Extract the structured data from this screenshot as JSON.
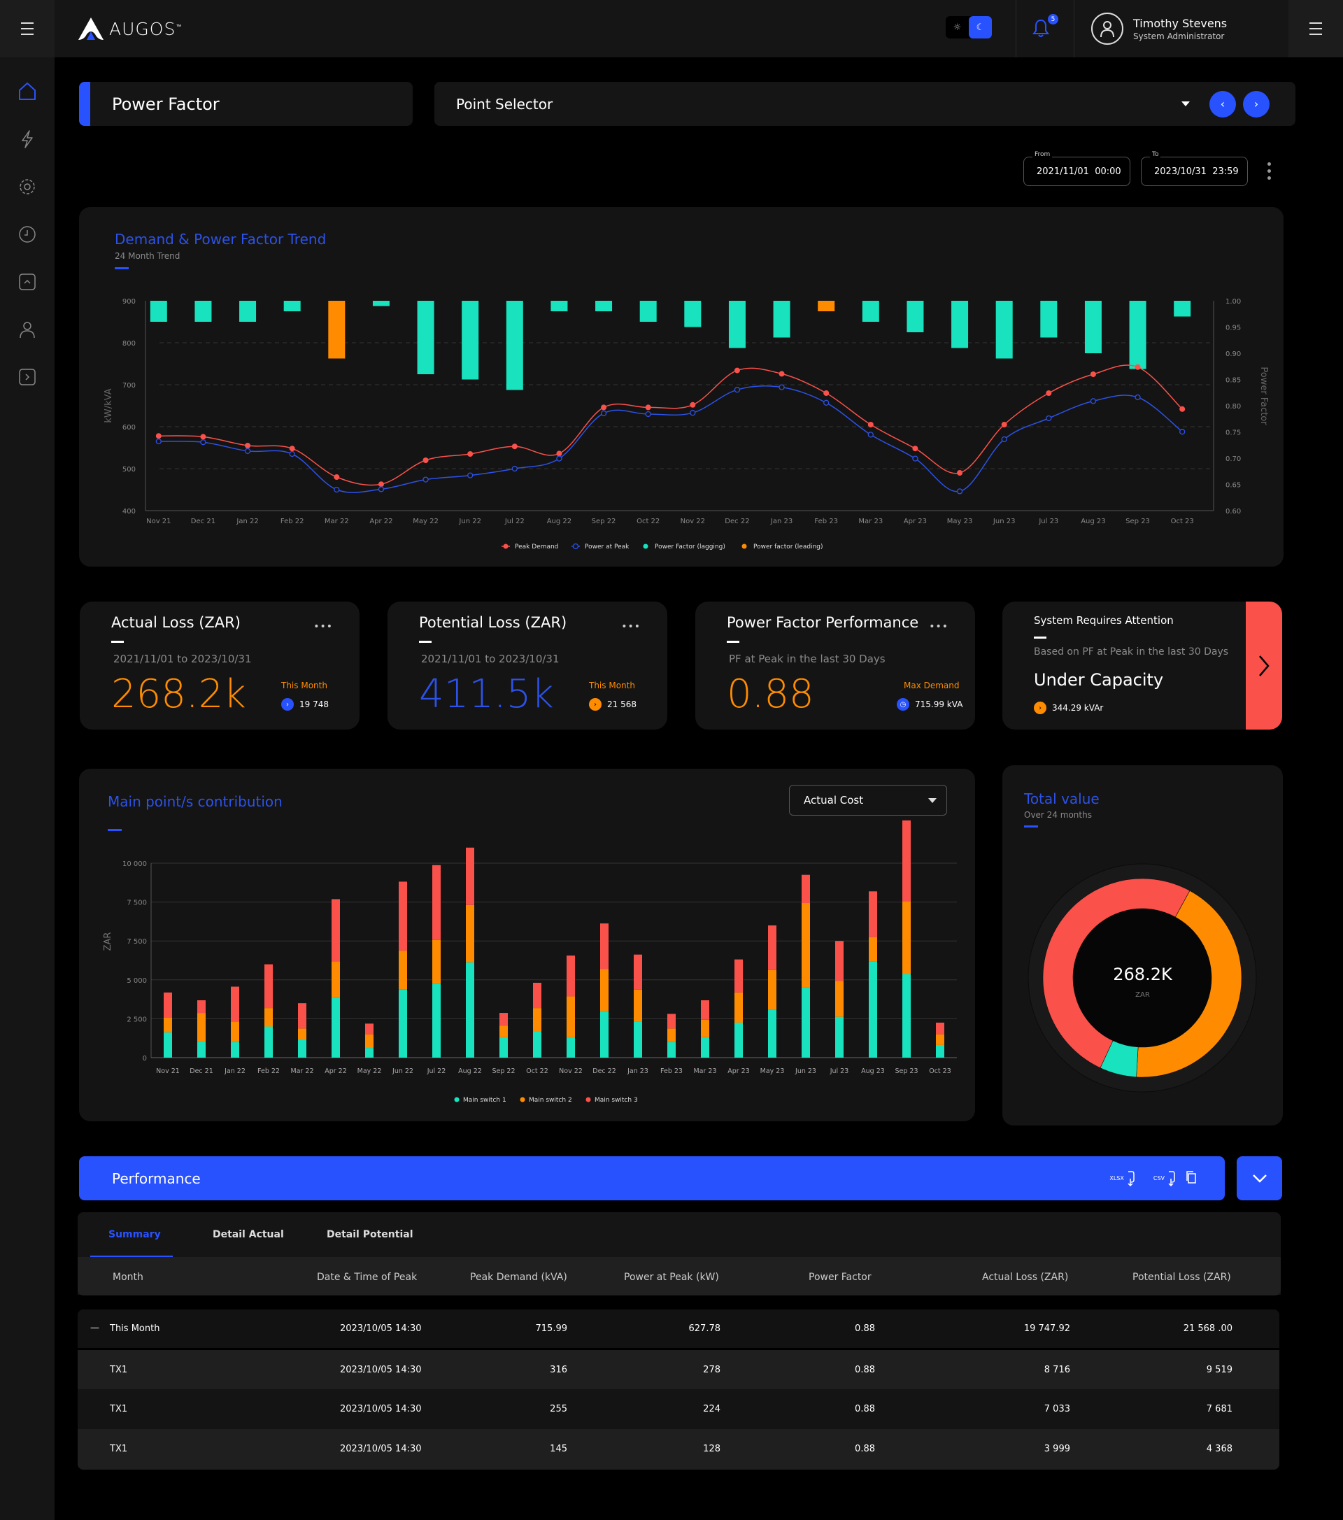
{
  "app": {
    "brand": "AUGOS",
    "trademark": "™"
  },
  "header": {
    "notifications_count": "5",
    "user_name": "Timothy Stevens",
    "user_role": "System Administrator",
    "theme": "dark"
  },
  "sidebar": {
    "items": [
      {
        "name": "home",
        "active": true
      },
      {
        "name": "energy"
      },
      {
        "name": "settings"
      },
      {
        "name": "history"
      },
      {
        "name": "collapse-up"
      },
      {
        "name": "users"
      },
      {
        "name": "expand-right"
      }
    ]
  },
  "page": {
    "title": "Power Factor",
    "point_selector": "Point Selector"
  },
  "date_range": {
    "from_label": "From",
    "from": "2021/11/01  00:00",
    "to_label": "To",
    "to": "2023/10/31  23:59"
  },
  "colors": {
    "accent": "#2952ff",
    "teal": "#19e3be",
    "orange": "#ff8c00",
    "red": "#fa514b",
    "blue": "#2d52e8"
  },
  "trend_card": {
    "title": "Demand & Power Factor Trend",
    "subtitle": "24 Month Trend"
  },
  "kpis": {
    "actual": {
      "title": "Actual Loss (ZAR)",
      "range": "2021/11/01 to 2023/10/31",
      "value": "268.2k",
      "this_month_label": "This Month",
      "this_month_value": "19 748"
    },
    "potential": {
      "title": "Potential Loss (ZAR)",
      "range": "2021/11/01 to 2023/10/31",
      "value": "411.5k",
      "this_month_label": "This Month",
      "this_month_value": "21 568"
    },
    "pf": {
      "title": "Power Factor Performance",
      "range": "PF at Peak in the last 30 Days",
      "value": "0.88",
      "max_label": "Max Demand",
      "max_value": "715.99 kVA"
    },
    "attention": {
      "title": "System Requires Attention",
      "basis": "Based on PF at Peak in the last 30 Days",
      "status": "Under Capacity",
      "value": "344.29 kVAr"
    }
  },
  "contribution_card": {
    "title": "Main point/s contribution",
    "dropdown": "Actual Cost"
  },
  "total_card": {
    "title": "Total value",
    "subtitle": "Over 24 months",
    "center_value": "268.2K",
    "center_unit": "ZAR"
  },
  "performance": {
    "title": "Performance",
    "export_xlsx": "XLSX",
    "export_csv": "CSV",
    "tabs": [
      "Summary",
      "Detail Actual",
      "Detail Potential"
    ],
    "active_tab": "Summary",
    "columns": [
      "Month",
      "Date & Time of Peak",
      "Peak Demand (kVA)",
      "Power at Peak (kW)",
      "Power Factor",
      "Actual Loss (ZAR)",
      "Potential Loss (ZAR)"
    ],
    "rows": [
      [
        "This Month",
        "2023/10/05 14:30",
        "715.99",
        "627.78",
        "0.88",
        "19 747.92",
        "21 568 .00"
      ],
      [
        "TX1",
        "2023/10/05 14:30",
        "316",
        "278",
        "0.88",
        "8 716",
        "9 519"
      ],
      [
        "TX1",
        "2023/10/05 14:30",
        "255",
        "224",
        "0.88",
        "7 033",
        "7 681"
      ],
      [
        "TX1",
        "2023/10/05 14:30",
        "145",
        "128",
        "0.88",
        "3 999",
        "4 368"
      ]
    ]
  },
  "chart_data": [
    {
      "type": "bar+line",
      "title": "Demand & Power Factor Trend",
      "subtitle": "24 Month Trend",
      "categories": [
        "Nov 21",
        "Dec 21",
        "Jan 22",
        "Feb 22",
        "Mar 22",
        "Apr 22",
        "May 22",
        "Jun 22",
        "Jul 22",
        "Aug 22",
        "Sep 22",
        "Oct 22",
        "Nov 22",
        "Dec 22",
        "Jan 23",
        "Feb 23",
        "Mar 23",
        "Apr 23",
        "May 23",
        "Jun 23",
        "Jul 23",
        "Aug 23",
        "Sep 23",
        "Oct 23"
      ],
      "ylabel": "kW/kVA",
      "y2label": "Power Factor",
      "ylim": [
        400,
        900
      ],
      "yticks": [
        "900",
        "800",
        "700",
        "600",
        "500",
        "400"
      ],
      "y2lim": [
        0.6,
        1.0
      ],
      "y2ticks": [
        "1.00",
        "0.95",
        "0.90",
        "0.85",
        "0.80",
        "0.75",
        "0.70",
        "0.65",
        "0.60"
      ],
      "series": [
        {
          "name": "Peak Demand",
          "type": "line",
          "axis": "left",
          "values": [
            578,
            576,
            555,
            548,
            480,
            463,
            520,
            535,
            553,
            536,
            646,
            646,
            652,
            734,
            726,
            680,
            605,
            548,
            490,
            605,
            680,
            725,
            742,
            642
          ]
        },
        {
          "name": "Power at Peak",
          "type": "line",
          "axis": "left",
          "values": [
            565,
            563,
            542,
            535,
            450,
            451,
            474,
            484,
            500,
            524,
            632,
            630,
            633,
            688,
            694,
            657,
            581,
            524,
            446,
            570,
            620,
            661,
            670,
            588
          ]
        },
        {
          "name": "Power Factor (lagging)",
          "type": "bar",
          "axis": "right",
          "values": [
            0.96,
            0.96,
            0.96,
            0.98,
            null,
            0.99,
            0.86,
            0.85,
            0.83,
            0.98,
            0.98,
            0.96,
            0.95,
            0.91,
            0.93,
            null,
            0.96,
            0.94,
            0.91,
            0.89,
            0.93,
            0.9,
            0.87,
            0.97
          ]
        },
        {
          "name": "Power factor (leading)",
          "type": "bar",
          "axis": "right",
          "values": [
            null,
            null,
            null,
            null,
            0.89,
            null,
            null,
            null,
            null,
            null,
            null,
            null,
            null,
            null,
            null,
            0.98,
            null,
            null,
            null,
            null,
            null,
            null,
            null,
            null
          ]
        }
      ],
      "legend": "bottom",
      "grid": true
    },
    {
      "type": "bar",
      "stacked": true,
      "title": "Main point/s contribution",
      "categories": [
        "Nov 21",
        "Dec 21",
        "Jan 22",
        "Feb 22",
        "Mar 22",
        "Apr 22",
        "May 22",
        "Jun 22",
        "Jul 22",
        "Aug 22",
        "Sep 22",
        "Oct 22",
        "Nov 22",
        "Dec 22",
        "Jan 23",
        "Feb 23",
        "Mar 23",
        "Apr 23",
        "May 23",
        "Jun 23",
        "Jul 23",
        "Aug 23",
        "Sep 23",
        "Oct 23"
      ],
      "ylabel": "ZAR",
      "ylim": [
        0,
        10000
      ],
      "yticks": [
        "10 000",
        "7 500",
        "7 500",
        "5 000",
        "2 500",
        "0"
      ],
      "series": [
        {
          "name": "Main switch 1",
          "values": [
            1300,
            850,
            800,
            1600,
            900,
            3100,
            500,
            3500,
            3800,
            4900,
            1050,
            1350,
            1050,
            2400,
            1850,
            800,
            1050,
            1800,
            2450,
            3600,
            2100,
            4950,
            4300,
            650
          ]
        },
        {
          "name": "Main switch 2",
          "values": [
            750,
            1450,
            1050,
            950,
            600,
            1850,
            700,
            2000,
            2250,
            2950,
            600,
            1200,
            2100,
            2150,
            1650,
            700,
            900,
            1550,
            2050,
            4350,
            1850,
            1250,
            3750,
            550
          ]
        },
        {
          "name": "Main switch 3",
          "values": [
            1300,
            650,
            1800,
            2250,
            1300,
            3200,
            550,
            3550,
            3850,
            2950,
            650,
            1300,
            2100,
            2350,
            1800,
            750,
            1000,
            1700,
            2300,
            1450,
            2050,
            2350,
            4150,
            600
          ]
        }
      ],
      "legend": "bottom",
      "grid": true
    },
    {
      "type": "pie",
      "title": "Total value",
      "subtitle": "Over 24 months",
      "center_label": "268.2K ZAR",
      "slices": [
        {
          "name": "Main switch 3",
          "value": 51
        },
        {
          "name": "Main switch 2",
          "value": 43
        },
        {
          "name": "Main switch 1",
          "value": 6
        }
      ]
    }
  ]
}
